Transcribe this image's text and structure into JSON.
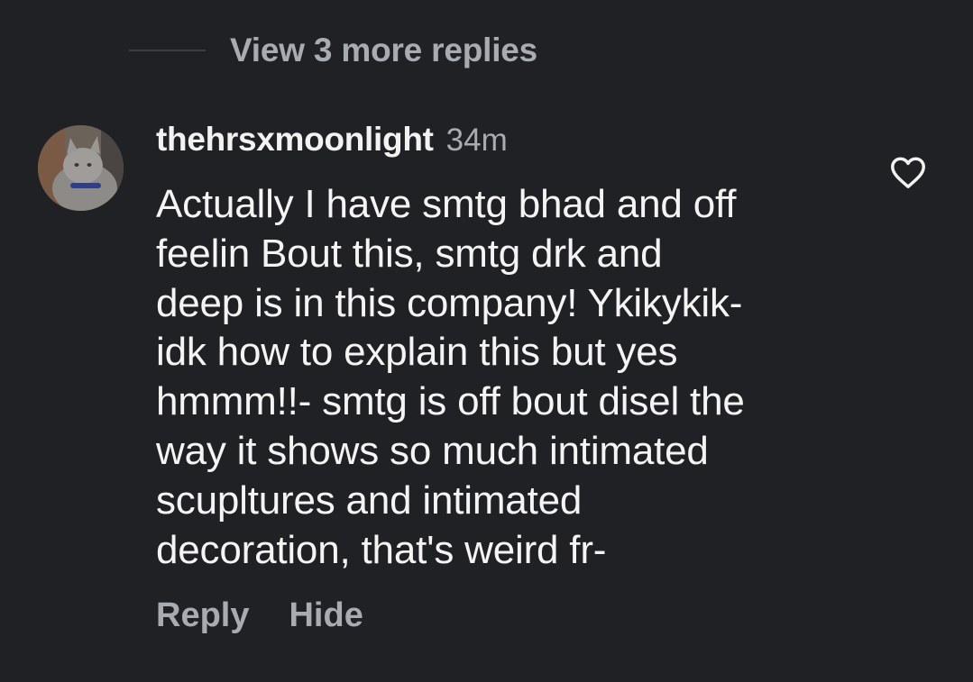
{
  "replies": {
    "view_more_label": "View 3 more replies"
  },
  "comment": {
    "username": "thehrsxmoonlight",
    "timestamp": "34m",
    "text_lines": [
      "Actually I have smtg bhad and off",
      "feelin Bout this, smtg drk and",
      "deep is in this company! Ykikykik-",
      "idk how to explain this but yes",
      "hmmm!!- smtg is off bout disel the",
      "way it shows so much intimated",
      "scupltures and intimated",
      "decoration, that's weird fr-"
    ],
    "actions": {
      "reply_label": "Reply",
      "hide_label": "Hide"
    },
    "like_icon": "heart-outline-icon",
    "avatar_icon": "cat-photo-avatar"
  },
  "colors": {
    "background": "#1f2124",
    "primary_text": "#f2f2f2",
    "secondary_text": "#a8abb0",
    "divider": "#3a3d42"
  }
}
